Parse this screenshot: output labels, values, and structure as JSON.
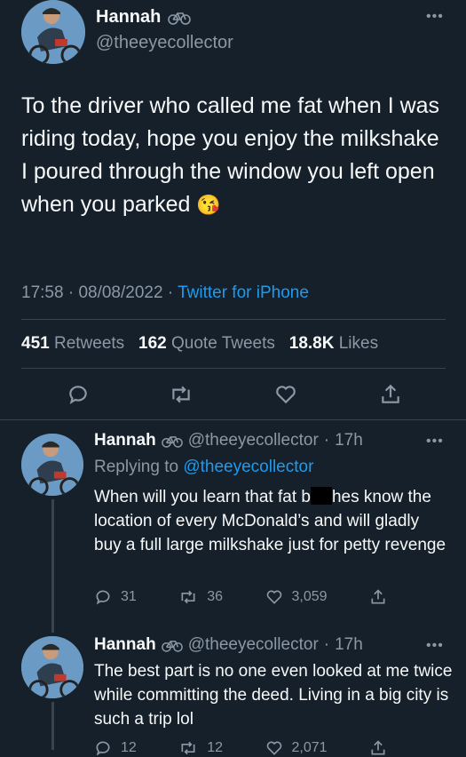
{
  "main_tweet": {
    "name": "Hannah",
    "handle": "@theeyecollector",
    "text": "To the driver who called me fat when I was riding today, hope you enjoy the milkshake I poured through the window you left open when you parked",
    "emoji": "😘",
    "time": "17:58",
    "date": "08/08/2022",
    "source": "Twitter for iPhone",
    "stats": {
      "retweets_count": "451",
      "retweets_label": "Retweets",
      "quotes_count": "162",
      "quotes_label": "Quote Tweets",
      "likes_count": "18.8K",
      "likes_label": "Likes"
    }
  },
  "replies": [
    {
      "name": "Hannah",
      "handle": "@theeyecollector",
      "age": "17h",
      "replying_label": "Replying to",
      "replying_to": "@theeyecollector",
      "text_before": "When will you learn that fat b",
      "text_after": "hes know the location of every McDonald’s and will gladly buy a full large milkshake just for petty revenge",
      "replies": "31",
      "retweets": "36",
      "likes": "3,059"
    },
    {
      "name": "Hannah",
      "handle": "@theeyecollector",
      "age": "17h",
      "text": "The best part is no one even looked at me twice while committing the deed. Living in a big city is such a trip lol",
      "replies": "12",
      "retweets": "12",
      "likes": "2,071"
    }
  ],
  "colors": {
    "background": "#15202b",
    "accent": "#1d9bf0",
    "muted": "#8b98a5",
    "divider": "#38444d"
  }
}
